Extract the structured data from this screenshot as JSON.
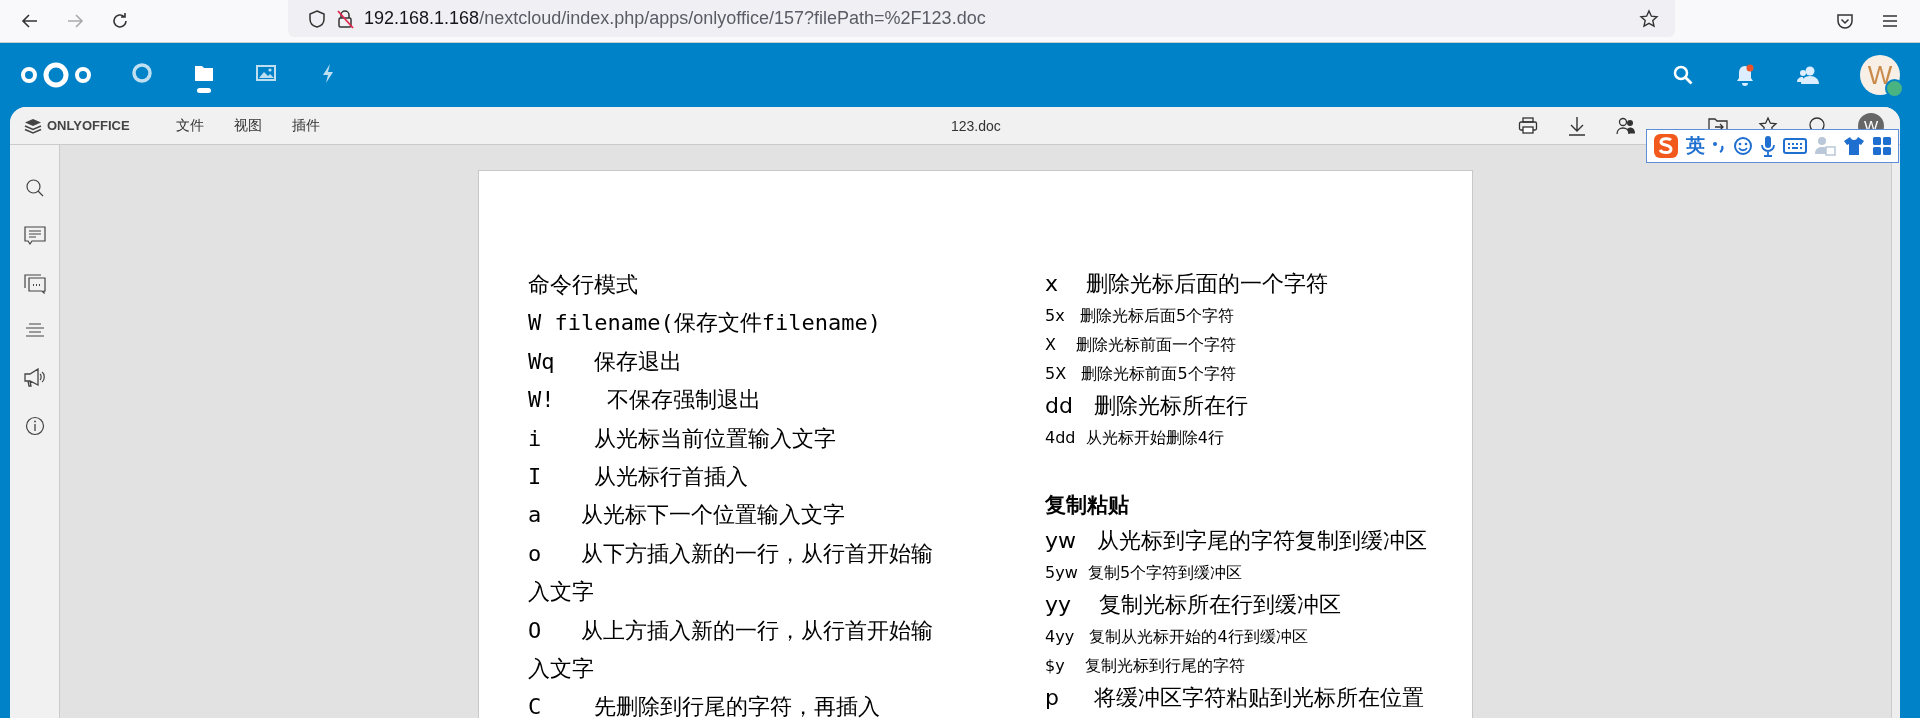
{
  "browser": {
    "url_host": "192.168.1.168",
    "url_path": "/nextcloud/index.php/apps/onlyoffice/157?filePath=%2F123.doc"
  },
  "nextcloud": {
    "apps": [
      {
        "kind": "dashboard",
        "selected": false
      },
      {
        "kind": "files",
        "selected": true
      },
      {
        "kind": "photos",
        "selected": false
      },
      {
        "kind": "activity",
        "selected": false
      }
    ],
    "notification_unread": true,
    "avatar": "W",
    "status_online": true
  },
  "editor": {
    "logo": "ONLYOFFICE",
    "menu": [
      "文件",
      "视图",
      "插件"
    ],
    "file_name": "123.doc",
    "user": "W"
  },
  "ime": {
    "mode": "英"
  },
  "document": {
    "left_lines": [
      {
        "text": "命令行模式"
      },
      {
        "text": "W filename(保存文件filename)"
      },
      {
        "text": "Wq   保存退出"
      },
      {
        "text": "W!    不保存强制退出"
      },
      {
        "text": "i    从光标当前位置输入文字"
      },
      {
        "text": "I    从光标行首插入"
      },
      {
        "text": "a   从光标下一个位置输入文字"
      },
      {
        "text": "o   从下方插入新的一行，从行首开始输入文字"
      },
      {
        "text": "O   从上方插入新的一行，从行首开始输入文字"
      },
      {
        "text": "C    先删除到行尾的字符，再插入"
      }
    ],
    "right_lines": [
      {
        "kind": "large",
        "text": "x    删除光标后面的一个字符"
      },
      {
        "kind": "small",
        "text": "5x   删除光标后面5个字符"
      },
      {
        "kind": "small",
        "text": "X    删除光标前面一个字符"
      },
      {
        "kind": "small",
        "text": "5X   删除光标前面5个字符"
      },
      {
        "kind": "large",
        "text": "dd   删除光标所在行"
      },
      {
        "kind": "small",
        "text": "4dd  从光标开始删除4行"
      },
      {
        "kind": "heading",
        "text": "复制粘贴"
      },
      {
        "kind": "large",
        "text": "yw   从光标到字尾的字符复制到缓冲区"
      },
      {
        "kind": "small",
        "text": "5yw  复制5个字符到缓冲区"
      },
      {
        "kind": "large",
        "text": "yy    复制光标所在行到缓冲区"
      },
      {
        "kind": "small",
        "text": "4yy   复制从光标开始的4行到缓冲区"
      },
      {
        "kind": "small",
        "text": "$y    复制光标到行尾的字符"
      },
      {
        "kind": "large",
        "text": "p     将缓冲区字符粘贴到光标所在位置"
      }
    ]
  }
}
